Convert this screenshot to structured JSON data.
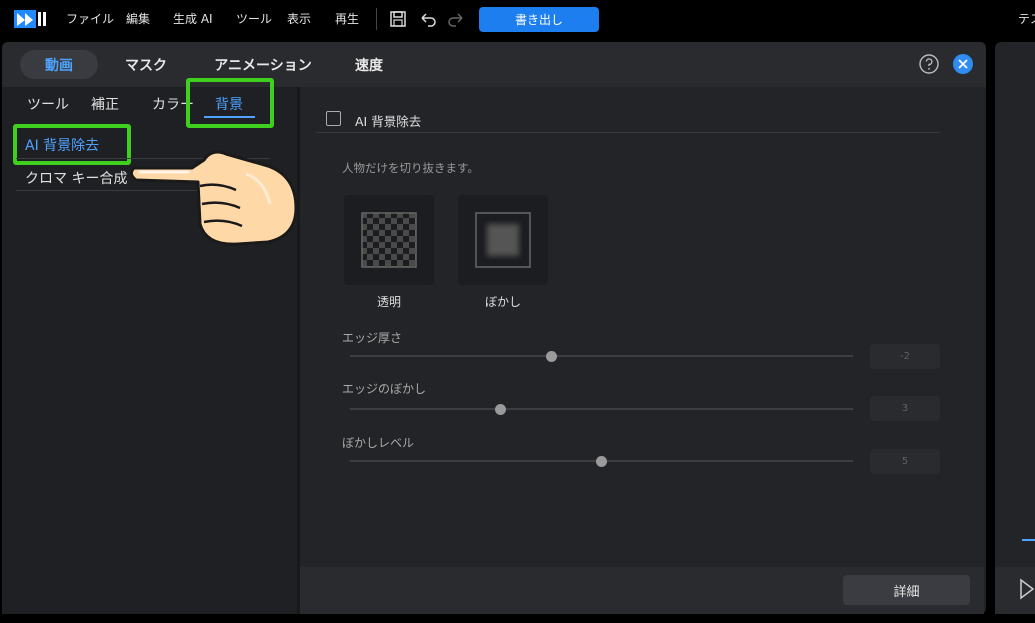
{
  "menubar": {
    "items": [
      "ファイル",
      "編集",
      "生成 AI",
      "ツール",
      "表示",
      "再生"
    ],
    "export_label": "書き出し",
    "right_text": "テス",
    "icons": [
      "app-logo-icon",
      "save-icon",
      "undo-icon",
      "redo-icon"
    ]
  },
  "main_tabs": [
    "動画",
    "マスク",
    "アニメーション",
    "速度"
  ],
  "sub_tabs": [
    "ツール",
    "補正",
    "カラー",
    "背景"
  ],
  "left_list": [
    "AI 背景除去",
    "クロマ キー合成"
  ],
  "panel": {
    "checkbox_label": "AI 背景除去",
    "checkbox_checked": false,
    "description": "人物だけを切り抜きます。",
    "thumbnails": [
      {
        "label": "透明",
        "icon": "transparent-checker-icon"
      },
      {
        "label": "ぼかし",
        "icon": "blur-square-icon"
      }
    ],
    "sliders": [
      {
        "label": "エッジ厚さ",
        "value": "-2",
        "level": 0.4
      },
      {
        "label": "エッジのぼかし",
        "value": "3",
        "level": 0.3
      },
      {
        "label": "ぼかしレベル",
        "value": "5",
        "level": 0.5
      }
    ],
    "detail_button": "詳細"
  },
  "colors": {
    "accent": "#4ea3ff",
    "export_button": "#1d7ef0",
    "highlight": "#3fd01f"
  }
}
